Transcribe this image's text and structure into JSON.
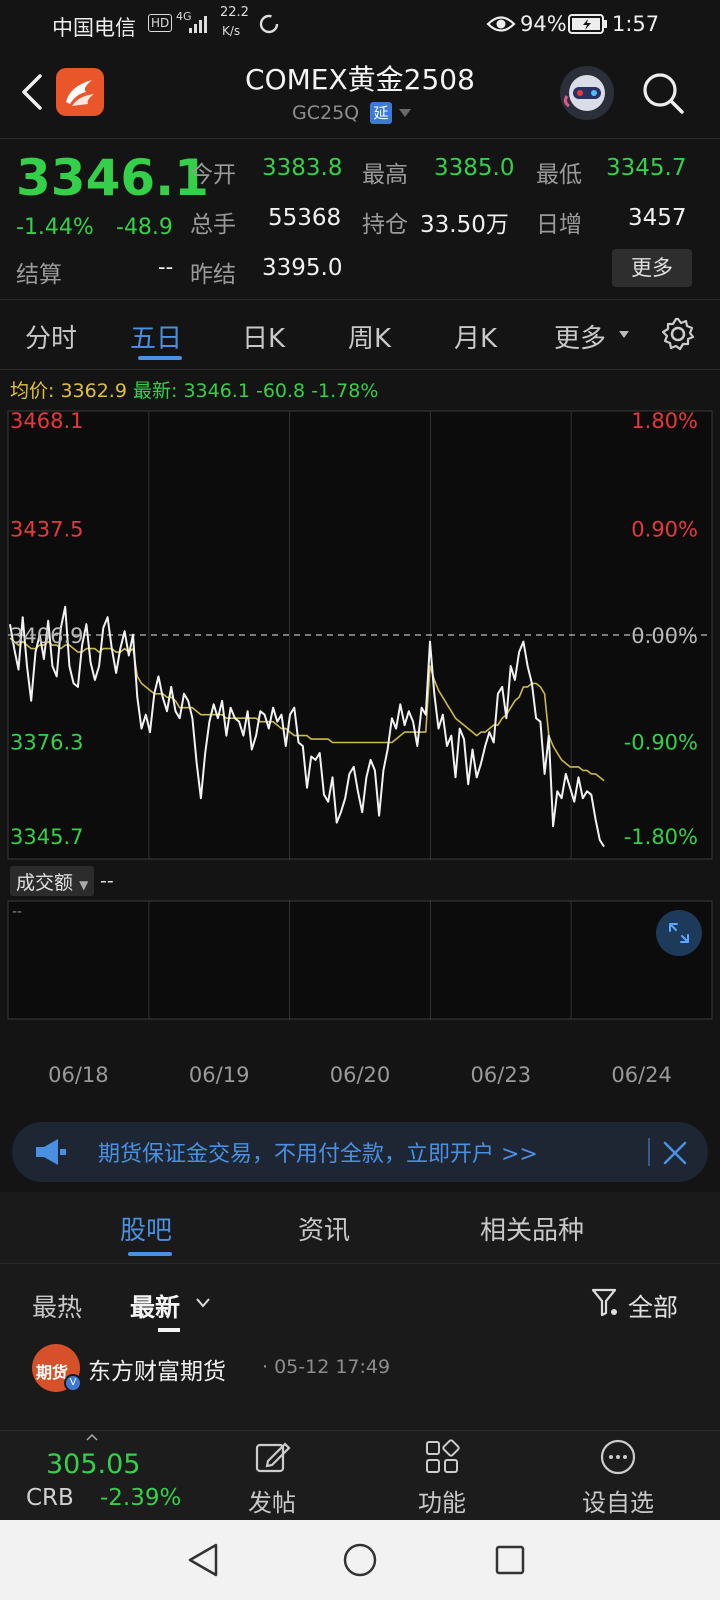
{
  "status": {
    "carrier": "中国电信",
    "hd": "HD",
    "net": "4G",
    "speed_top": "22.2",
    "speed_unit": "K/s",
    "battery_pct": "94%",
    "time": "1:57"
  },
  "header": {
    "title": "COMEX黄金2508",
    "code": "GC25Q",
    "delay_badge": "延"
  },
  "quote": {
    "price": "3346.1",
    "pct_change": "-1.44%",
    "change": "-48.9",
    "settle_label": "结算",
    "settle_value": "--",
    "fields": [
      {
        "label": "今开",
        "value": "3383.8"
      },
      {
        "label": "最高",
        "value": "3385.0"
      },
      {
        "label": "最低",
        "value": "3345.7"
      },
      {
        "label": "总手",
        "value": "55368"
      },
      {
        "label": "持仓",
        "value": "33.50万"
      },
      {
        "label": "日增",
        "value": "3457"
      },
      {
        "label": "昨结",
        "value": "3395.0"
      }
    ],
    "more_button": "更多"
  },
  "tabs": [
    "分时",
    "五日",
    "日K",
    "周K",
    "月K",
    "更多"
  ],
  "active_tab": 1,
  "chart_info": {
    "avg_label": "均价:",
    "avg_value": "3362.9",
    "latest_label": "最新:",
    "latest_value": "3346.1",
    "latest_change": "-60.8",
    "latest_pct": "-1.78%",
    "volume_label": "成交额",
    "volume_value": "--",
    "volume_axis": "--"
  },
  "chart_data": {
    "type": "line",
    "y_ticks_left": [
      "3468.1",
      "3437.5",
      "3406.9",
      "3376.3",
      "3345.7"
    ],
    "y_ticks_right": [
      "1.80%",
      "0.90%",
      "0.00%",
      "-0.90%",
      "-1.80%"
    ],
    "ylim": [
      3345.7,
      3468.1
    ],
    "reference": 3406.9,
    "x_labels": [
      "06/18",
      "06/19",
      "06/20",
      "06/23",
      "06/24"
    ],
    "series": [
      {
        "values": [
          3410,
          3403,
          3397,
          3412,
          3398,
          3388,
          3402,
          3407,
          3400,
          3411,
          3398,
          3395,
          3409,
          3415,
          3398,
          3393,
          3392,
          3404,
          3410,
          3399,
          3394,
          3398,
          3409,
          3412,
          3403,
          3396,
          3403,
          3408,
          3401,
          3407,
          3389,
          3380,
          3384,
          3379,
          3390,
          3395,
          3389,
          3385,
          3392,
          3385,
          3383,
          3390,
          3388,
          3383,
          3370,
          3360,
          3373,
          3382,
          3387,
          3383,
          3388,
          3378,
          3386,
          3383,
          3382,
          3378,
          3385,
          3374,
          3378,
          3385,
          3384,
          3380,
          3386,
          3382,
          3384,
          3375,
          3384,
          3386,
          3376,
          3375,
          3363,
          3372,
          3371,
          3373,
          3361,
          3359,
          3366,
          3353,
          3356,
          3360,
          3367,
          3369,
          3362,
          3356,
          3366,
          3371,
          3368,
          3355,
          3368,
          3374,
          3383,
          3380,
          3387,
          3381,
          3385,
          3382,
          3375,
          3386,
          3384,
          3405,
          3390,
          3380,
          3384,
          3375,
          3378,
          3366,
          3380,
          3377,
          3364,
          3374,
          3366,
          3370,
          3375,
          3379,
          3376,
          3390,
          3392,
          3383,
          3398,
          3394,
          3402,
          3405,
          3398,
          3393,
          3383,
          3382,
          3367,
          3378,
          3352,
          3362,
          3360,
          3367,
          3363,
          3359,
          3366,
          3360,
          3362,
          3361,
          3354,
          3348,
          3346.1
        ]
      },
      {
        "values": [
          3406,
          3405,
          3404,
          3405,
          3404,
          3403,
          3403,
          3404,
          3404,
          3405,
          3404,
          3404,
          3403,
          3404,
          3404,
          3403,
          3402,
          3402,
          3403,
          3403,
          3403,
          3402,
          3403,
          3403,
          3403,
          3402,
          3402,
          3403,
          3402,
          3403,
          3395,
          3393,
          3392,
          3391,
          3390,
          3390,
          3390,
          3389,
          3389,
          3388,
          3386,
          3386,
          3386,
          3386,
          3385,
          3384,
          3384,
          3384,
          3384,
          3384,
          3384,
          3383,
          3383,
          3383,
          3383,
          3383,
          3383,
          3383,
          3383,
          3382,
          3382,
          3382,
          3382,
          3381,
          3380,
          3380,
          3379,
          3378,
          3378,
          3378,
          3378,
          3377,
          3377,
          3377,
          3377,
          3377,
          3376,
          3376,
          3376,
          3376,
          3376,
          3376,
          3376,
          3376,
          3376,
          3376,
          3376,
          3376,
          3376,
          3376,
          3376,
          3377,
          3378,
          3379,
          3379,
          3379,
          3379,
          3379,
          3379,
          3398,
          3394,
          3391,
          3389,
          3387,
          3385,
          3383,
          3382,
          3381,
          3380,
          3379,
          3378,
          3379,
          3379,
          3380,
          3381,
          3381,
          3383,
          3384,
          3386,
          3388,
          3389,
          3392,
          3392,
          3393,
          3393,
          3392,
          3390,
          3378,
          3375,
          3373,
          3371,
          3370,
          3369,
          3369,
          3369,
          3368,
          3368,
          3367,
          3367,
          3366,
          3365
        ]
      }
    ],
    "colors": {
      "price": "#f2f2f2",
      "avg": "#c9b94a",
      "ref": "#bbbbbb",
      "up": "#e8373d",
      "down": "#35d04a"
    }
  },
  "banner": {
    "text": "期货保证金交易，不用付全款，立即开户 >>"
  },
  "subtabs": [
    "股吧",
    "资讯",
    "相关品种"
  ],
  "filter": {
    "hot": "最热",
    "latest": "最新",
    "all": "全部"
  },
  "post": {
    "author": "东方财富期货",
    "avatar_text": "期货",
    "time": "· 05-12 17:49"
  },
  "bottombar": {
    "index_value": "305.05",
    "index_name": "CRB",
    "index_change": "-2.39%",
    "items": [
      "发帖",
      "功能",
      "设自选"
    ]
  }
}
